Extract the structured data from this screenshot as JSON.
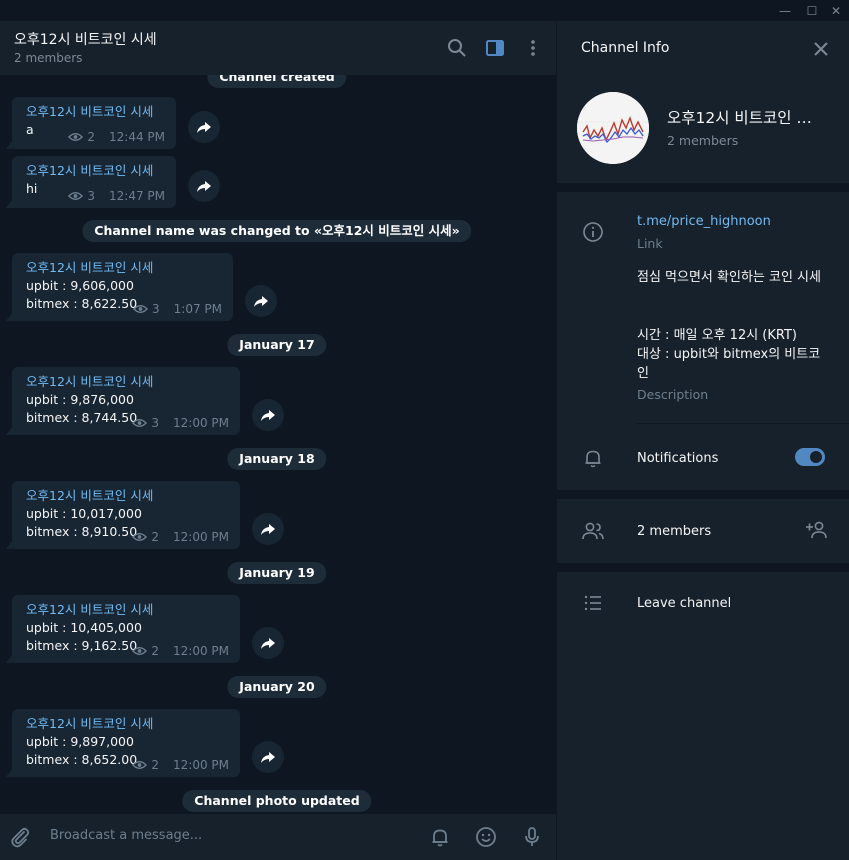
{
  "window": {
    "minimize": "—",
    "maximize": "☐",
    "close": "✕"
  },
  "chat": {
    "title": "오후12시 비트코인 시세",
    "subtitle": "2 members",
    "service": {
      "created": "Channel created",
      "renamed": "Channel name was changed to «오후12시 비트코인 시세»",
      "photo": "Channel photo updated"
    },
    "dates": [
      "January 17",
      "January 18",
      "January 19",
      "January 20"
    ],
    "messages": [
      {
        "author": "오후12시 비트코인 시세",
        "lines": [
          "a"
        ],
        "views": "2",
        "time": "12:44 PM"
      },
      {
        "author": "오후12시 비트코인 시세",
        "lines": [
          "hi"
        ],
        "views": "3",
        "time": "12:47 PM"
      },
      {
        "author": "오후12시 비트코인 시세",
        "lines": [
          "upbit : 9,606,000",
          "bitmex : 8,622.50"
        ],
        "views": "3",
        "time": "1:07 PM"
      },
      {
        "author": "오후12시 비트코인 시세",
        "lines": [
          "upbit : 9,876,000",
          "bitmex : 8,744.50"
        ],
        "views": "3",
        "time": "12:00 PM"
      },
      {
        "author": "오후12시 비트코인 시세",
        "lines": [
          "upbit : 10,017,000",
          "bitmex : 8,910.50"
        ],
        "views": "2",
        "time": "12:00 PM"
      },
      {
        "author": "오후12시 비트코인 시세",
        "lines": [
          "upbit : 10,405,000",
          "bitmex : 9,162.50"
        ],
        "views": "2",
        "time": "12:00 PM"
      },
      {
        "author": "오후12시 비트코인 시세",
        "lines": [
          "upbit : 9,897,000",
          "bitmex : 8,652.00"
        ],
        "views": "2",
        "time": "12:00 PM"
      }
    ],
    "composer_placeholder": "Broadcast a message..."
  },
  "info": {
    "title": "Channel Info",
    "name": "오후12시 비트코인 …",
    "members_sub": "2 members",
    "link": "t.me/price_highnoon",
    "link_label": "Link",
    "description_line1": "점심 먹으면서 확인하는 코인 시세",
    "description_line2": "시간 : 매일 오후 12시 (KRT)",
    "description_line3": "대상 : upbit와 bitmex의 비트코인",
    "description_label": "Description",
    "notifications": "Notifications",
    "notifications_on": true,
    "members": "2 members",
    "leave": "Leave channel"
  },
  "colors": {
    "accent": "#5288c1",
    "link": "#71baf2",
    "bg": "#0e1621",
    "panel": "#17212b",
    "bubble": "#182533"
  }
}
